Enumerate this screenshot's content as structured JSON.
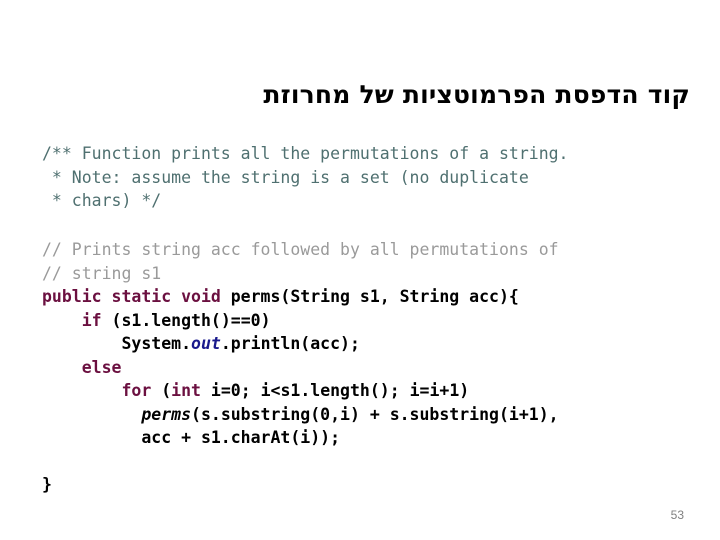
{
  "slide": {
    "title": "קוד הדפסת הפרמוטציות של מחרוזת",
    "page_number": "53",
    "background_color": "#ffffff"
  },
  "colors": {
    "doc_comment": "#4f7070",
    "line_comment": "#9a9a9a",
    "keyword": "#6b1040",
    "field": "#1a1a8c",
    "text": "#000000",
    "page_number": "#808080"
  },
  "doc_comment": {
    "lines": [
      "/** Function prints all the permutations of a string.",
      " * Note: assume the string is a set (no duplicate",
      " * chars) */"
    ]
  },
  "code": {
    "lines": [
      {
        "id": "comment-1",
        "tokens": [
          {
            "text": "// Prints string acc followed by all permutations of",
            "style": "comment"
          }
        ]
      },
      {
        "id": "comment-2",
        "tokens": [
          {
            "text": "// string s1",
            "style": "comment"
          }
        ]
      },
      {
        "id": "signature",
        "tokens": [
          {
            "text": "public static void ",
            "style": "keyword-bold"
          },
          {
            "text": "perms(String s1, String acc){",
            "style": "plain-bold"
          }
        ]
      },
      {
        "id": "if-statement",
        "tokens": [
          {
            "text": "    ",
            "style": "plain-bold"
          },
          {
            "text": "if",
            "style": "keyword-bold"
          },
          {
            "text": " (s1.length()==0)",
            "style": "plain-bold"
          }
        ]
      },
      {
        "id": "println-statement",
        "tokens": [
          {
            "text": "        System.",
            "style": "plain-bold"
          },
          {
            "text": "out",
            "style": "field"
          },
          {
            "text": ".println(acc);",
            "style": "plain-bold"
          }
        ]
      },
      {
        "id": "else-statement",
        "tokens": [
          {
            "text": "    ",
            "style": "plain-bold"
          },
          {
            "text": "else",
            "style": "keyword-bold"
          }
        ]
      },
      {
        "id": "for-statement",
        "tokens": [
          {
            "text": "        ",
            "style": "plain-bold"
          },
          {
            "text": "for",
            "style": "keyword-bold"
          },
          {
            "text": " (",
            "style": "plain-bold"
          },
          {
            "text": "int",
            "style": "keyword-bold"
          },
          {
            "text": " i=0; i<s1.length(); i=i+1)",
            "style": "plain-bold"
          }
        ]
      },
      {
        "id": "recursive-call-1",
        "tokens": [
          {
            "text": "          ",
            "style": "plain-bold"
          },
          {
            "text": "perms",
            "style": "method"
          },
          {
            "text": "(s.substring(0,i) + s.substring(i+1),",
            "style": "plain-bold"
          }
        ]
      },
      {
        "id": "recursive-call-2",
        "tokens": [
          {
            "text": "          acc + s1.charAt(i));",
            "style": "plain-bold"
          }
        ]
      },
      {
        "id": "blank-1",
        "tokens": [
          {
            "text": " ",
            "style": "plain-bold"
          }
        ]
      },
      {
        "id": "closing-brace",
        "tokens": [
          {
            "text": "}",
            "style": "plain-bold"
          }
        ]
      }
    ]
  }
}
